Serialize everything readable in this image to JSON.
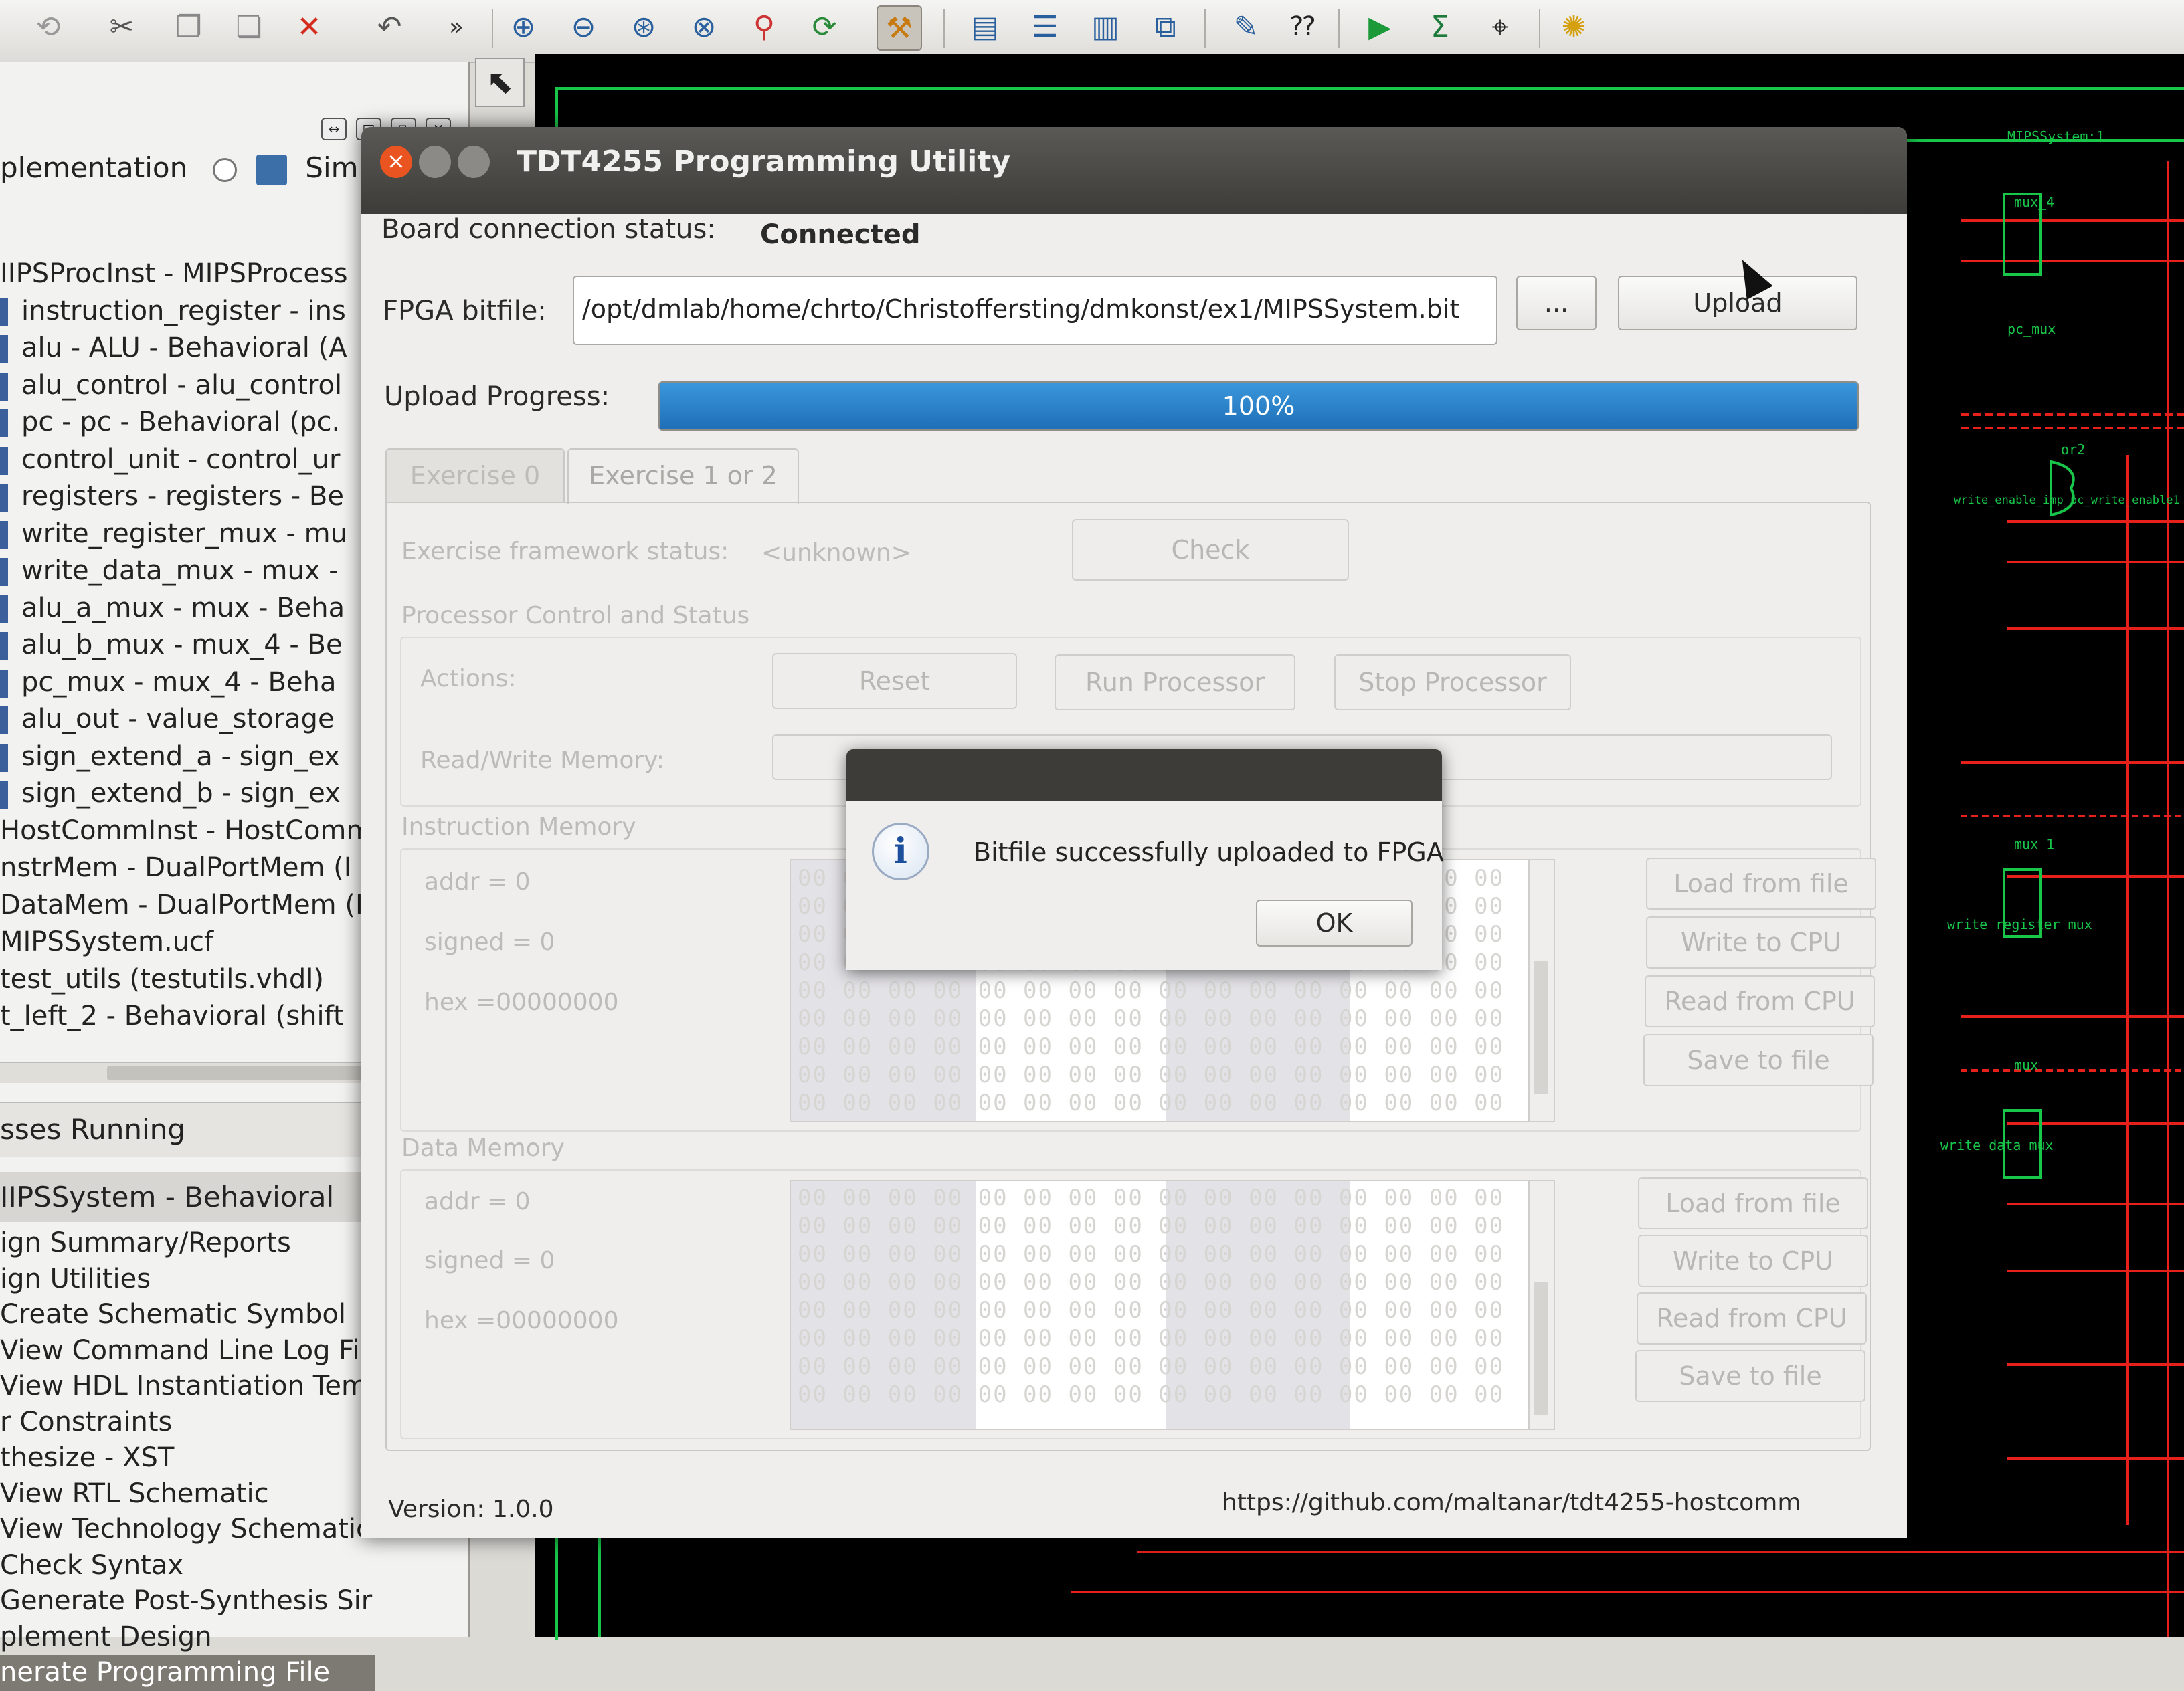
{
  "ide": {
    "view_implementation": "plementation",
    "view_simulation": "Simulation",
    "hierarchy": [
      "IIPSProcInst - MIPSProcess",
      "instruction_register - ins",
      "alu - ALU - Behavioral (A",
      "alu_control - alu_control",
      "pc - pc - Behavioral (pc.",
      "control_unit - control_ur",
      "registers - registers - Be",
      "write_register_mux - mu",
      "write_data_mux - mux -",
      "alu_a_mux - mux - Beha",
      "alu_b_mux - mux_4 - Be",
      "pc_mux - mux_4 - Beha",
      "alu_out - value_storage",
      "sign_extend_a - sign_ex",
      "sign_extend_b - sign_ex",
      "HostCommInst - HostComm",
      "nstrMem - DualPortMem (I",
      "DataMem - DualPortMem (I",
      "MIPSSystem.ucf",
      "test_utils (testutils.vhdl)",
      "t_left_2 - Behavioral (shift"
    ],
    "processes_header": "sses Running",
    "processes_top": "IIPSSystem - Behavioral",
    "processes": [
      "ign Summary/Reports",
      "ign Utilities",
      "Create Schematic Symbol",
      "View Command Line Log Fil",
      "View HDL Instantiation Tem",
      "r Constraints",
      "thesize - XST",
      "View RTL Schematic",
      "View Technology Schematic",
      "Check Syntax",
      "Generate Post-Synthesis Sir",
      "plement Design",
      "nerate Programming File"
    ],
    "schematic_labels": {
      "system": "MIPSSystem:1",
      "mux4": "mux_4",
      "pcmux": "pc_mux",
      "or2": "or2",
      "write_enable": "write_enable_imp_pc_write_enable1",
      "mux1": "mux_1",
      "write_register_mux": "write_register_mux",
      "mux": "mux",
      "write_data_mux": "write_data_mux"
    }
  },
  "dialog": {
    "title": "TDT4255 Programming Utility",
    "board_status_label": "Board connection status:",
    "board_status_value": "Connected",
    "bitfile_label": "FPGA bitfile:",
    "bitfile_value": "/opt/dmlab/home/chrto/Christoffersting/dmkonst/ex1/MIPSSystem.bit",
    "browse_label": "...",
    "upload_label": "Upload",
    "progress_label": "Upload Progress:",
    "progress_text": "100%",
    "progress_fraction": 1.0,
    "tabs": [
      "Exercise 0",
      "Exercise 1 or 2"
    ],
    "framework_status_label": "Exercise framework status:",
    "framework_status_value": "<unknown>",
    "check_label": "Check",
    "processor_group": "Processor Control and Status",
    "actions_label": "Actions:",
    "reset_label": "Reset",
    "run_label": "Run Processor",
    "stop_label": "Stop Processor",
    "rw_memory_label": "Read/Write Memory:",
    "instruction_memory": {
      "title": "Instruction Memory",
      "addr": "addr = 0",
      "signed": "signed = 0",
      "hex": "hex =00000000",
      "buttons": [
        "Load from file",
        "Write to CPU",
        "Read from CPU",
        "Save to file"
      ]
    },
    "data_memory": {
      "title": "Data Memory",
      "addr": "addr = 0",
      "signed": "signed = 0",
      "hex": "hex =00000000",
      "buttons": [
        "Load from file",
        "Write to CPU",
        "Read from CPU",
        "Save to file"
      ]
    },
    "hex_row": "00 00 00 00 00 00 00 00 00 00 00 00 00 00 00 00",
    "version": "Version: 1.0.0",
    "url": "https://github.com/maltanar/tdt4255-hostcomm"
  },
  "message_box": {
    "text": "Bitfile successfully uploaded to FPGA",
    "ok_label": "OK"
  }
}
